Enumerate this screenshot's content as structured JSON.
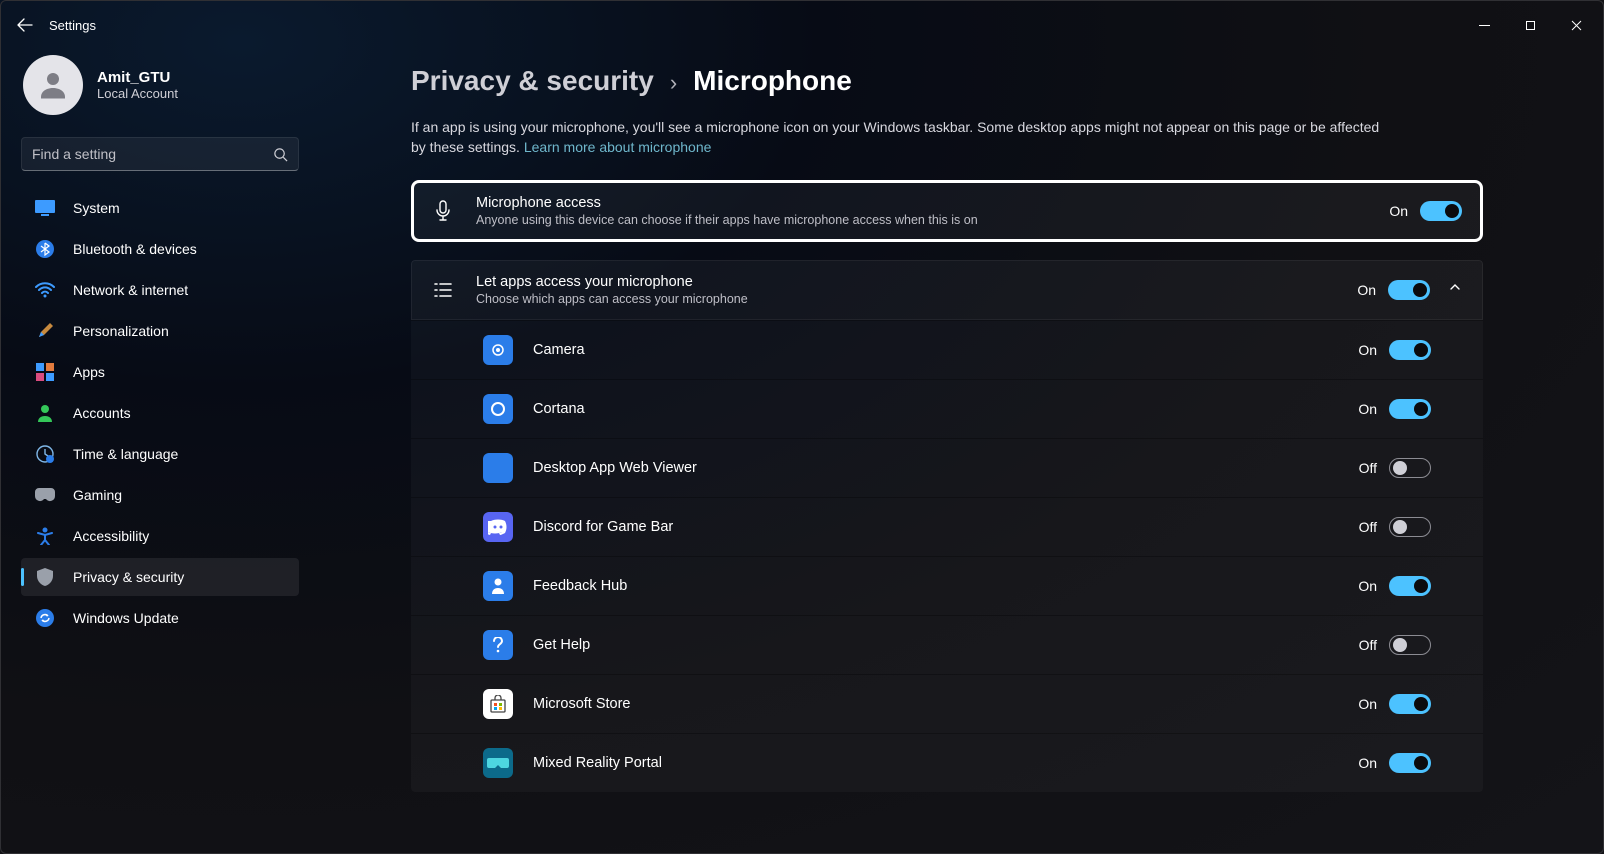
{
  "window": {
    "title": "Settings"
  },
  "user": {
    "name": "Amit_GTU",
    "subtitle": "Local Account"
  },
  "search": {
    "placeholder": "Find a setting"
  },
  "nav": {
    "items": [
      {
        "label": "System"
      },
      {
        "label": "Bluetooth & devices"
      },
      {
        "label": "Network & internet"
      },
      {
        "label": "Personalization"
      },
      {
        "label": "Apps"
      },
      {
        "label": "Accounts"
      },
      {
        "label": "Time & language"
      },
      {
        "label": "Gaming"
      },
      {
        "label": "Accessibility"
      },
      {
        "label": "Privacy & security"
      },
      {
        "label": "Windows Update"
      }
    ]
  },
  "breadcrumb": {
    "parent": "Privacy & security",
    "current": "Microphone",
    "sep": "›"
  },
  "intro": {
    "text": "If an app is using your microphone, you'll see a microphone icon on your Windows taskbar. Some desktop apps might not appear on this page or be affected by these settings.  ",
    "link": "Learn more about microphone"
  },
  "toggle_states": {
    "on": "On",
    "off": "Off"
  },
  "mic_access": {
    "title": "Microphone access",
    "subtitle": "Anyone using this device can choose if their apps have microphone access when this is on",
    "state": "On"
  },
  "let_apps": {
    "title": "Let apps access your microphone",
    "subtitle": "Choose which apps can access your microphone",
    "state": "On"
  },
  "apps": [
    {
      "name": "Camera",
      "state": "On",
      "color": "#2b7de9"
    },
    {
      "name": "Cortana",
      "state": "On",
      "color": "#2b7de9"
    },
    {
      "name": "Desktop App Web Viewer",
      "state": "Off",
      "color": "#2b7de9"
    },
    {
      "name": "Discord for Game Bar",
      "state": "Off",
      "color": "#5865f2"
    },
    {
      "name": "Feedback Hub",
      "state": "On",
      "color": "#2b7de9"
    },
    {
      "name": "Get Help",
      "state": "Off",
      "color": "#2b7de9"
    },
    {
      "name": "Microsoft Store",
      "state": "On",
      "color": "#ffffff"
    },
    {
      "name": "Mixed Reality Portal",
      "state": "On",
      "color": "#0c6a8a"
    }
  ]
}
